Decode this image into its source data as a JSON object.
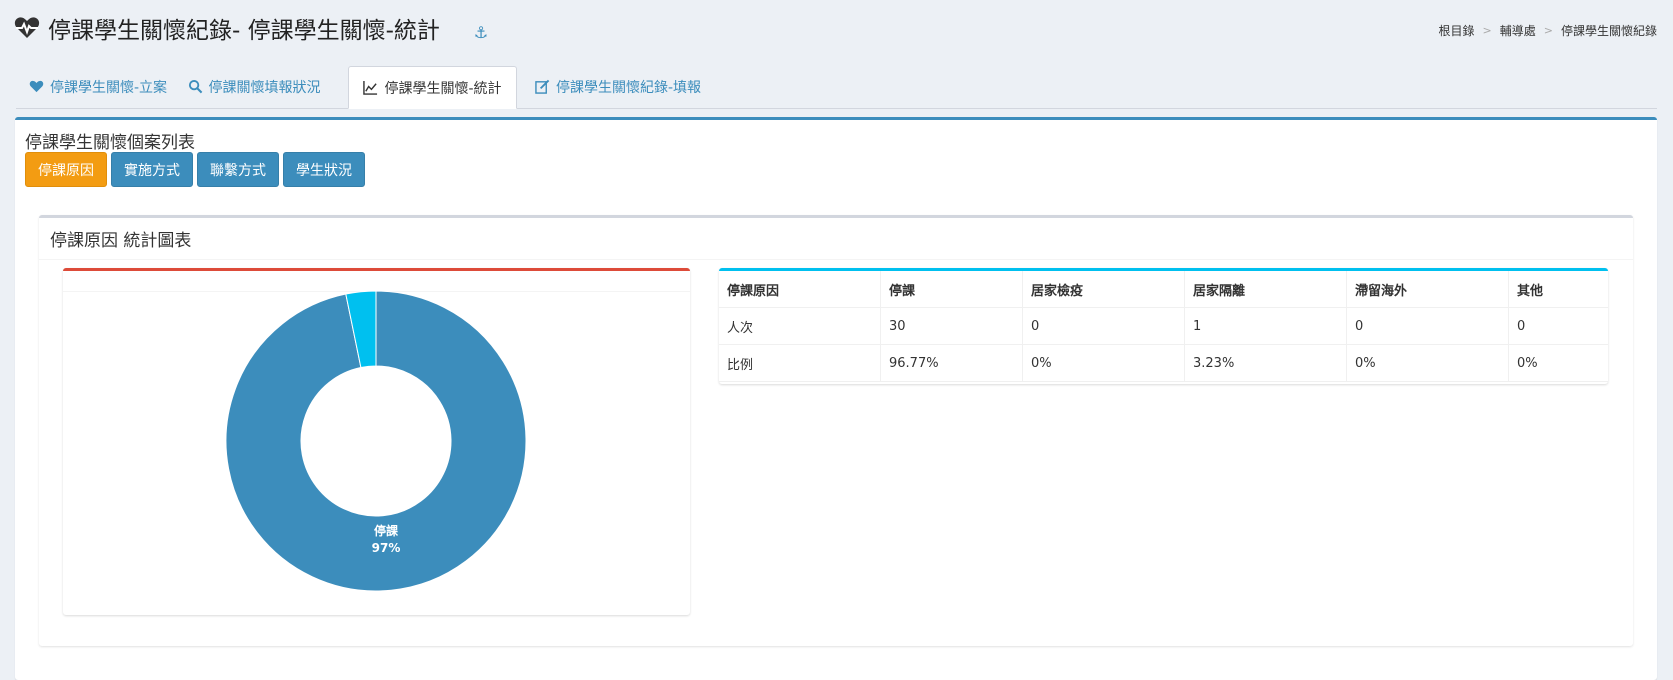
{
  "header": {
    "title": "停課學生關懷紀錄- 停課學生關懷-統計",
    "breadcrumb": [
      "根目錄",
      "輔導處",
      "停課學生關懷紀錄"
    ]
  },
  "tabs": [
    {
      "label": "停課學生關懷-立案",
      "icon": "heart-icon"
    },
    {
      "label": "停課關懷填報狀況",
      "icon": "search-icon"
    },
    {
      "label": "停課學生關懷-統計",
      "icon": "line-chart-icon"
    },
    {
      "label": "停課學生關懷紀錄-填報",
      "icon": "edit-icon"
    }
  ],
  "box": {
    "title": "停課學生關懷個案列表",
    "buttons": [
      "停課原因",
      "實施方式",
      "聯繫方式",
      "學生狀況"
    ]
  },
  "stats": {
    "title": "停課原因 統計圖表"
  },
  "table": {
    "headers": [
      "停課原因",
      "停課",
      "居家檢疫",
      "居家隔離",
      "滯留海外",
      "其他"
    ],
    "rows": [
      [
        "人次",
        "30",
        "0",
        "1",
        "0",
        "0"
      ],
      [
        "比例",
        "96.77%",
        "0%",
        "3.23%",
        "0%",
        "0%"
      ]
    ]
  },
  "chart_data": {
    "type": "pie",
    "categories": [
      "停課",
      "居家檢疫",
      "居家隔離",
      "滯留海外",
      "其他"
    ],
    "values": [
      30,
      0,
      1,
      0,
      0
    ],
    "colors": [
      "#3c8dbc",
      "#f56954",
      "#00c0ef",
      "#00a65a",
      "#f39c12"
    ],
    "data_labels": [
      {
        "name": "停課",
        "percent": "97%"
      }
    ]
  },
  "colors": {
    "primary": "#3c8dbc",
    "warning": "#f39c12",
    "danger": "#dd4b39",
    "info": "#00c0ef"
  }
}
